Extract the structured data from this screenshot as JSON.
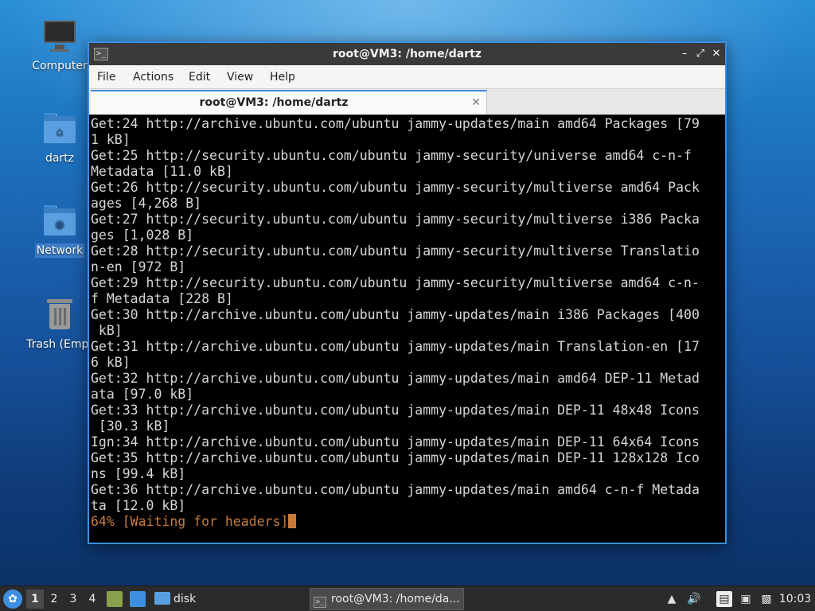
{
  "desktop": {
    "icons": [
      {
        "label": "Computer",
        "icon": "computer-icon"
      },
      {
        "label": "dartz",
        "icon": "home-folder-icon"
      },
      {
        "label": "Network",
        "icon": "network-folder-icon",
        "selected": true
      },
      {
        "label": "Trash (Empt",
        "icon": "trash-icon"
      }
    ]
  },
  "window": {
    "title": "root@VM3: /home/dartz",
    "buttons": {
      "minimize": "–",
      "maximize": "⤢",
      "close": "✕"
    },
    "menu": [
      "File",
      "Actions",
      "Edit",
      "View",
      "Help"
    ],
    "tab": {
      "label": "root@VM3: /home/dartz",
      "close": "✕"
    },
    "terminal": {
      "lines": [
        "Get:24 http://archive.ubuntu.com/ubuntu jammy-updates/main amd64 Packages [79",
        "1 kB]",
        "Get:25 http://security.ubuntu.com/ubuntu jammy-security/universe amd64 c-n-f",
        "Metadata [11.0 kB]",
        "Get:26 http://security.ubuntu.com/ubuntu jammy-security/multiverse amd64 Pack",
        "ages [4,268 B]",
        "Get:27 http://security.ubuntu.com/ubuntu jammy-security/multiverse i386 Packa",
        "ges [1,028 B]",
        "Get:28 http://security.ubuntu.com/ubuntu jammy-security/multiverse Translatio",
        "n-en [972 B]",
        "Get:29 http://security.ubuntu.com/ubuntu jammy-security/multiverse amd64 c-n-",
        "f Metadata [228 B]",
        "Get:30 http://archive.ubuntu.com/ubuntu jammy-updates/main i386 Packages [400",
        " kB]",
        "Get:31 http://archive.ubuntu.com/ubuntu jammy-updates/main Translation-en [17",
        "6 kB]",
        "Get:32 http://archive.ubuntu.com/ubuntu jammy-updates/main amd64 DEP-11 Metad",
        "ata [97.0 kB]",
        "Get:33 http://archive.ubuntu.com/ubuntu jammy-updates/main DEP-11 48x48 Icons",
        " [30.3 kB]",
        "Ign:34 http://archive.ubuntu.com/ubuntu jammy-updates/main DEP-11 64x64 Icons",
        "Get:35 http://archive.ubuntu.com/ubuntu jammy-updates/main DEP-11 128x128 Ico",
        "ns [99.4 kB]",
        "Get:36 http://archive.ubuntu.com/ubuntu jammy-updates/main amd64 c-n-f Metada",
        "ta [12.0 kB]"
      ],
      "progress_line": "64% [Waiting for headers]",
      "progress_color": "#c97a3a"
    }
  },
  "taskbar": {
    "workspaces": [
      "1",
      "2",
      "3",
      "4"
    ],
    "active_workspace": "1",
    "disk_label": "disk",
    "task_label": "root@VM3: /home/da...",
    "clock": "10:03",
    "accent": "#3d8fe0"
  }
}
